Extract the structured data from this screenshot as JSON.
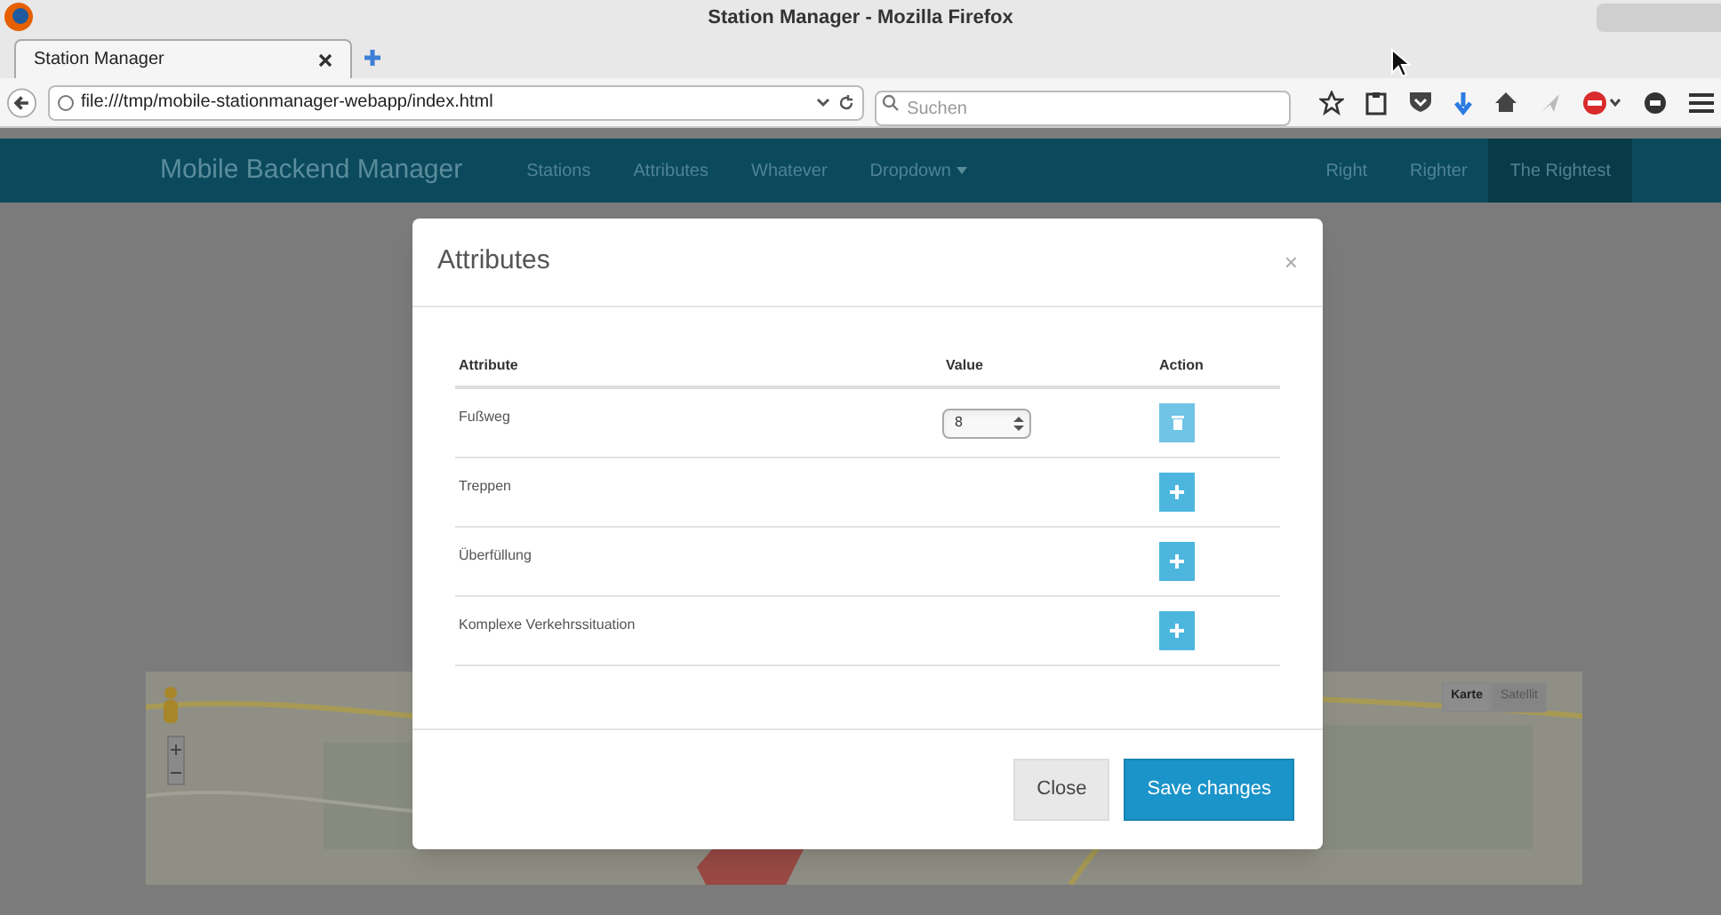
{
  "window": {
    "title": "Station Manager - Mozilla Firefox"
  },
  "tabs": [
    {
      "label": "Station Manager",
      "selected": true
    }
  ],
  "address_bar": {
    "value": "file:///tmp/mobile-stationmanager-webapp/index.html"
  },
  "search": {
    "placeholder": "Suchen"
  },
  "navbar": {
    "brand": "Mobile Backend Manager",
    "left_items": [
      {
        "label": "Stations",
        "selected": false
      },
      {
        "label": "Attributes",
        "selected": false
      },
      {
        "label": "Whatever",
        "selected": false
      },
      {
        "label": "Dropdown",
        "selected": false,
        "dropdown": true
      }
    ],
    "right_items": [
      {
        "label": "Right",
        "selected": false
      },
      {
        "label": "Righter",
        "selected": false
      },
      {
        "label": "The Rightest",
        "selected": true
      }
    ]
  },
  "map": {
    "map_types": [
      {
        "label": "Karte",
        "selected": true
      },
      {
        "label": "Satellit",
        "selected": false
      }
    ]
  },
  "modal": {
    "title": "Attributes",
    "close": "×",
    "columns": [
      "Attribute",
      "Value",
      "Action"
    ],
    "rows": [
      {
        "attribute": "Fußweg",
        "value": "8",
        "kind": "remove"
      },
      {
        "attribute": "Treppen",
        "kind": "add"
      },
      {
        "attribute": "Überfüllung",
        "kind": "add"
      },
      {
        "attribute": "Komplexe Verkehrssituation",
        "kind": "add"
      }
    ],
    "buttons": [
      {
        "label": "Close",
        "kind": "default"
      },
      {
        "label": "Save changes",
        "kind": "primary"
      }
    ]
  }
}
